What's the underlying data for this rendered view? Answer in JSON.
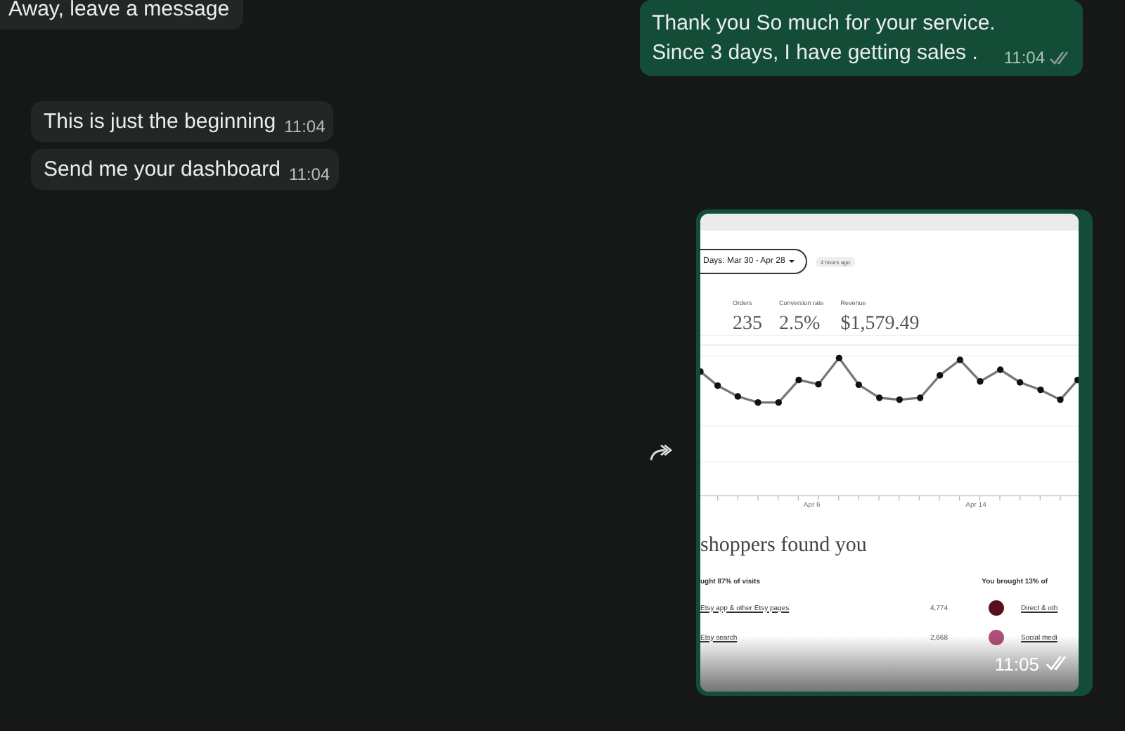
{
  "messages": [
    {
      "kind": "text",
      "outgoing": false,
      "text": "Away, leave a message"
    },
    {
      "kind": "text",
      "outgoing": true,
      "text": "Thank you So much for your service.\nSince 3 days, I have getting sales .",
      "time": "11:04",
      "read": false
    },
    {
      "kind": "text",
      "outgoing": false,
      "text": "This is just the beginning",
      "time": "11:04"
    },
    {
      "kind": "text",
      "outgoing": false,
      "text": "Send me your dashboard",
      "time": "11:04"
    },
    {
      "kind": "image",
      "outgoing": true,
      "time": "11:05",
      "read": false,
      "forward": true,
      "screenshot": {
        "date_range": "Days: Mar 30 - Apr 28",
        "updated": "4 hours ago",
        "stats": [
          {
            "label": "Orders",
            "value": "235",
            "selected": false
          },
          {
            "label": "Conversion rate",
            "value": "2.5%",
            "selected": false
          },
          {
            "label": "Revenue",
            "value": "$1,579.49",
            "selected": false
          }
        ],
        "x_labels": [
          "Apr 6",
          "Apr 14"
        ],
        "section_title": "shoppers found you",
        "left_heading": "ught 87% of visits",
        "right_heading": "You brought 13% of",
        "rows": [
          {
            "source": "Etsy app & other Etsy pages",
            "visits": "4,774",
            "color": "#5a0f1e",
            "other": "Direct & oth"
          },
          {
            "source": "Etsy search",
            "visits": "2,668",
            "color": "#b0507a",
            "other": "Social medi"
          }
        ]
      }
    }
  ]
}
